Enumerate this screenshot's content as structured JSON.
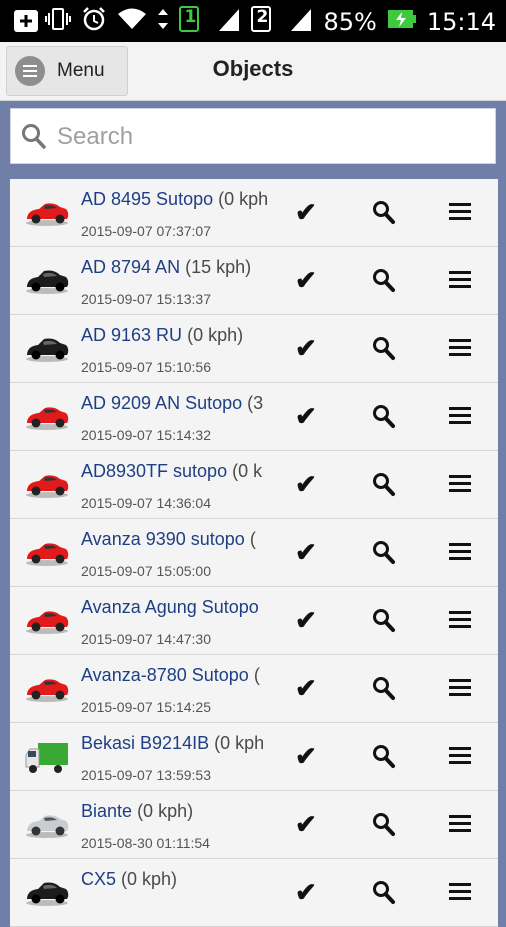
{
  "status_bar": {
    "battery": "85%",
    "time": "15:14",
    "sim1": "1",
    "sim2": "2"
  },
  "header": {
    "menu_label": "Menu",
    "title": "Objects"
  },
  "search": {
    "placeholder": "Search"
  },
  "objects": [
    {
      "name": "AD 8495 Sutopo",
      "speed": "(0 kph",
      "time": "2015-09-07 07:37:07",
      "icon": "red-car-icon"
    },
    {
      "name": "AD 8794 AN",
      "speed": "(15 kph)",
      "time": "2015-09-07 15:13:37",
      "icon": "black-car-icon"
    },
    {
      "name": "AD 9163 RU",
      "speed": "(0 kph)",
      "time": "2015-09-07 15:10:56",
      "icon": "black-car-icon"
    },
    {
      "name": "AD 9209 AN Sutopo",
      "speed": "(3",
      "time": "2015-09-07 15:14:32",
      "icon": "red-car-icon"
    },
    {
      "name": "AD8930TF sutopo",
      "speed": "(0 k",
      "time": "2015-09-07 14:36:04",
      "icon": "red-car-icon"
    },
    {
      "name": "Avanza 9390 sutopo",
      "speed": "(",
      "time": "2015-09-07 15:05:00",
      "icon": "red-car-icon"
    },
    {
      "name": "Avanza Agung Sutopo",
      "speed": "",
      "time": "2015-09-07 14:47:30",
      "icon": "red-car-icon"
    },
    {
      "name": "Avanza-8780 Sutopo",
      "speed": "(",
      "time": "2015-09-07 15:14:25",
      "icon": "red-car-icon"
    },
    {
      "name": "Bekasi B9214IB",
      "speed": "(0 kph",
      "time": "2015-09-07 13:59:53",
      "icon": "green-truck-icon"
    },
    {
      "name": "Biante",
      "speed": "(0 kph)",
      "time": "2015-08-30 01:11:54",
      "icon": "silver-car-icon"
    },
    {
      "name": "CX5",
      "speed": "(0 kph)",
      "time": "",
      "icon": "black-car-icon"
    }
  ],
  "colors": {
    "red_car": "#e11b1b",
    "black_car": "#1c1c1c",
    "silver_car": "#c9ccd2",
    "truck_cab": "#e6e6e6",
    "truck_box": "#39a935",
    "name_text": "#1f3f84"
  }
}
